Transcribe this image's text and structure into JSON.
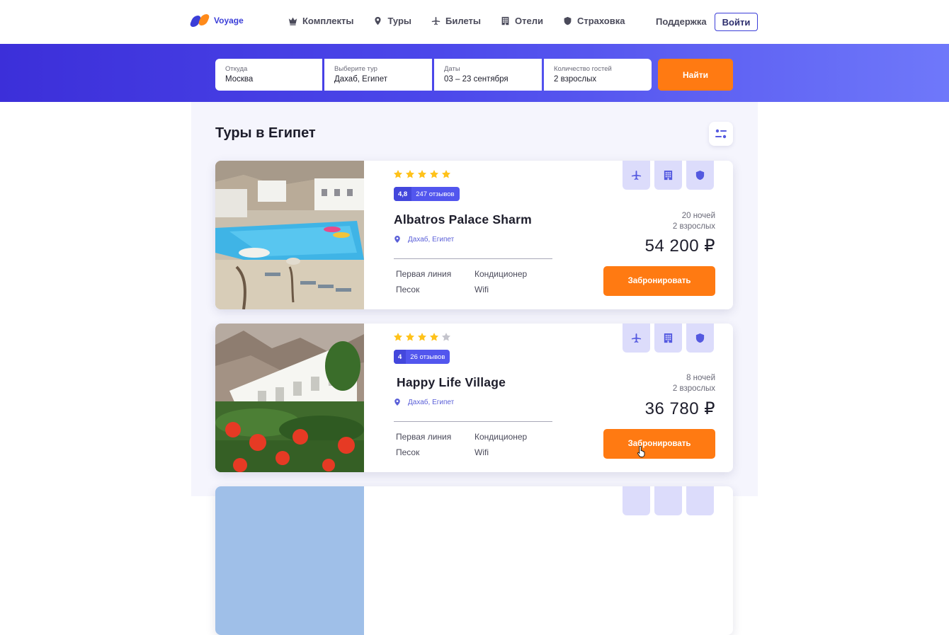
{
  "header": {
    "logo_text": "Voyage",
    "nav": [
      {
        "label": "Комплекты",
        "icon": "crown-icon"
      },
      {
        "label": "Туры",
        "icon": "location-pin-icon"
      },
      {
        "label": "Билеты",
        "icon": "plane-icon"
      },
      {
        "label": "Отели",
        "icon": "building-icon"
      },
      {
        "label": "Страховка",
        "icon": "shield-icon"
      }
    ],
    "support": "Поддержка",
    "login": "Войти"
  },
  "search": {
    "from": {
      "label": "Откуда",
      "value": "Москва"
    },
    "tour": {
      "label": "Выберите тур",
      "value": "Дахаб, Египет"
    },
    "dates": {
      "label": "Даты",
      "value": "03 – 23 сентября"
    },
    "guests": {
      "label": "Количество гостей",
      "value": "2 взрослых"
    },
    "button": "Найти"
  },
  "main": {
    "title": "Туры в Египет",
    "filter_icon": "sliders-icon"
  },
  "tours": [
    {
      "stars": 5,
      "rating": "4,8",
      "reviews": "247 отзывов",
      "name": "Albatros Palace Sharm",
      "location": "Дахаб, Египет",
      "features": [
        "Первая линия",
        "Кондиционер",
        "Песок",
        "Wifi"
      ],
      "nights": "20 ночей",
      "adults": "2 взрослых",
      "price": "54 200 ₽",
      "book": "Забронировать",
      "services": [
        "plane-icon",
        "building-icon",
        "shield-icon"
      ]
    },
    {
      "stars": 4,
      "rating": "4",
      "reviews": "26 отзывов",
      "name": "Happy Life Village",
      "location": "Дахаб, Египет",
      "features": [
        "Первая линия",
        "Кондиционер",
        "Песок",
        "Wifi"
      ],
      "nights": "8 ночей",
      "adults": "2 взрослых",
      "price": "36 780 ₽",
      "book": "Забронировать",
      "services": [
        "plane-icon",
        "building-icon",
        "shield-icon"
      ]
    }
  ],
  "colors": {
    "accent": "#3b3ed8",
    "cta": "#ff7a12",
    "star": "#ffc21a",
    "star_empty": "#c4c4cc"
  }
}
